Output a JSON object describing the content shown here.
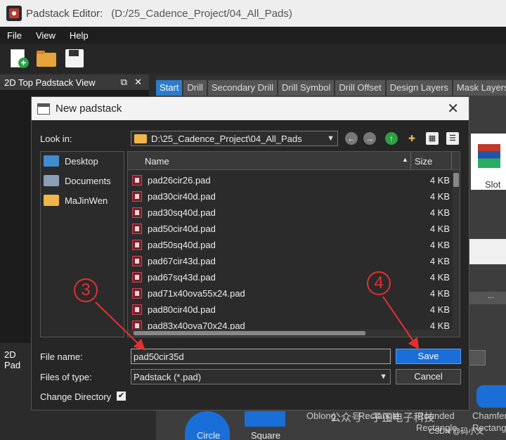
{
  "window": {
    "app_name": "Padstack Editor:",
    "path": "(D:/25_Cadence_Project/04_All_Pads)"
  },
  "menu": [
    "File",
    "View",
    "Help"
  ],
  "toolbar": {
    "icons": [
      "new-file-icon",
      "open-folder-icon",
      "save-icon"
    ]
  },
  "left_dock": {
    "title": "2D Top Padstack View",
    "float_icon": "⧉",
    "close_icon": "✕",
    "second_title": "2D Pad"
  },
  "tabs": [
    "Start",
    "Drill",
    "Secondary Drill",
    "Drill Symbol",
    "Drill Offset",
    "Design Layers",
    "Mask Layers"
  ],
  "right_panel": {
    "slot_label": "Slot",
    "shapes": [
      "Circle",
      "Square",
      "Oblong",
      "Rectangle",
      "Rounded",
      "Chamfer"
    ],
    "shape_row2": [
      "Rectangle",
      "Rectang"
    ]
  },
  "dialog": {
    "title": "New padstack",
    "close_icon": "✕",
    "look_in_label": "Look in:",
    "look_in_value": "D:\\25_Cadence_Project\\04_All_Pads",
    "sidebar": [
      "Desktop",
      "Documents",
      "MaJinWen"
    ],
    "columns": {
      "name": "Name",
      "size": "Size"
    },
    "files": [
      {
        "name": "pad26cir26.pad",
        "size": "4 KB"
      },
      {
        "name": "pad30cir40d.pad",
        "size": "4 KB"
      },
      {
        "name": "pad30sq40d.pad",
        "size": "4 KB"
      },
      {
        "name": "pad50cir40d.pad",
        "size": "4 KB"
      },
      {
        "name": "pad50sq40d.pad",
        "size": "4 KB"
      },
      {
        "name": "pad67cir43d.pad",
        "size": "4 KB"
      },
      {
        "name": "pad67sq43d.pad",
        "size": "4 KB"
      },
      {
        "name": "pad71x40ova55x24.pad",
        "size": "4 KB"
      },
      {
        "name": "pad80cir40d.pad",
        "size": "4 KB"
      },
      {
        "name": "pad83x40ova70x24.pad",
        "size": "4 KB"
      }
    ],
    "file_name_label": "File name:",
    "file_name_value": "pad50cir35d",
    "save_label": "Save",
    "file_type_label": "Files of type:",
    "file_type_value": "Padstack (*.pad)",
    "cancel_label": "Cancel",
    "change_dir_label": "Change Directory",
    "change_dir_checked": true
  },
  "annotations": {
    "step3": "3",
    "step4": "4",
    "color": "#e53030"
  },
  "watermark": {
    "main": "公众号 · 子正电子科技",
    "csdn": "CSDN @码小文"
  }
}
